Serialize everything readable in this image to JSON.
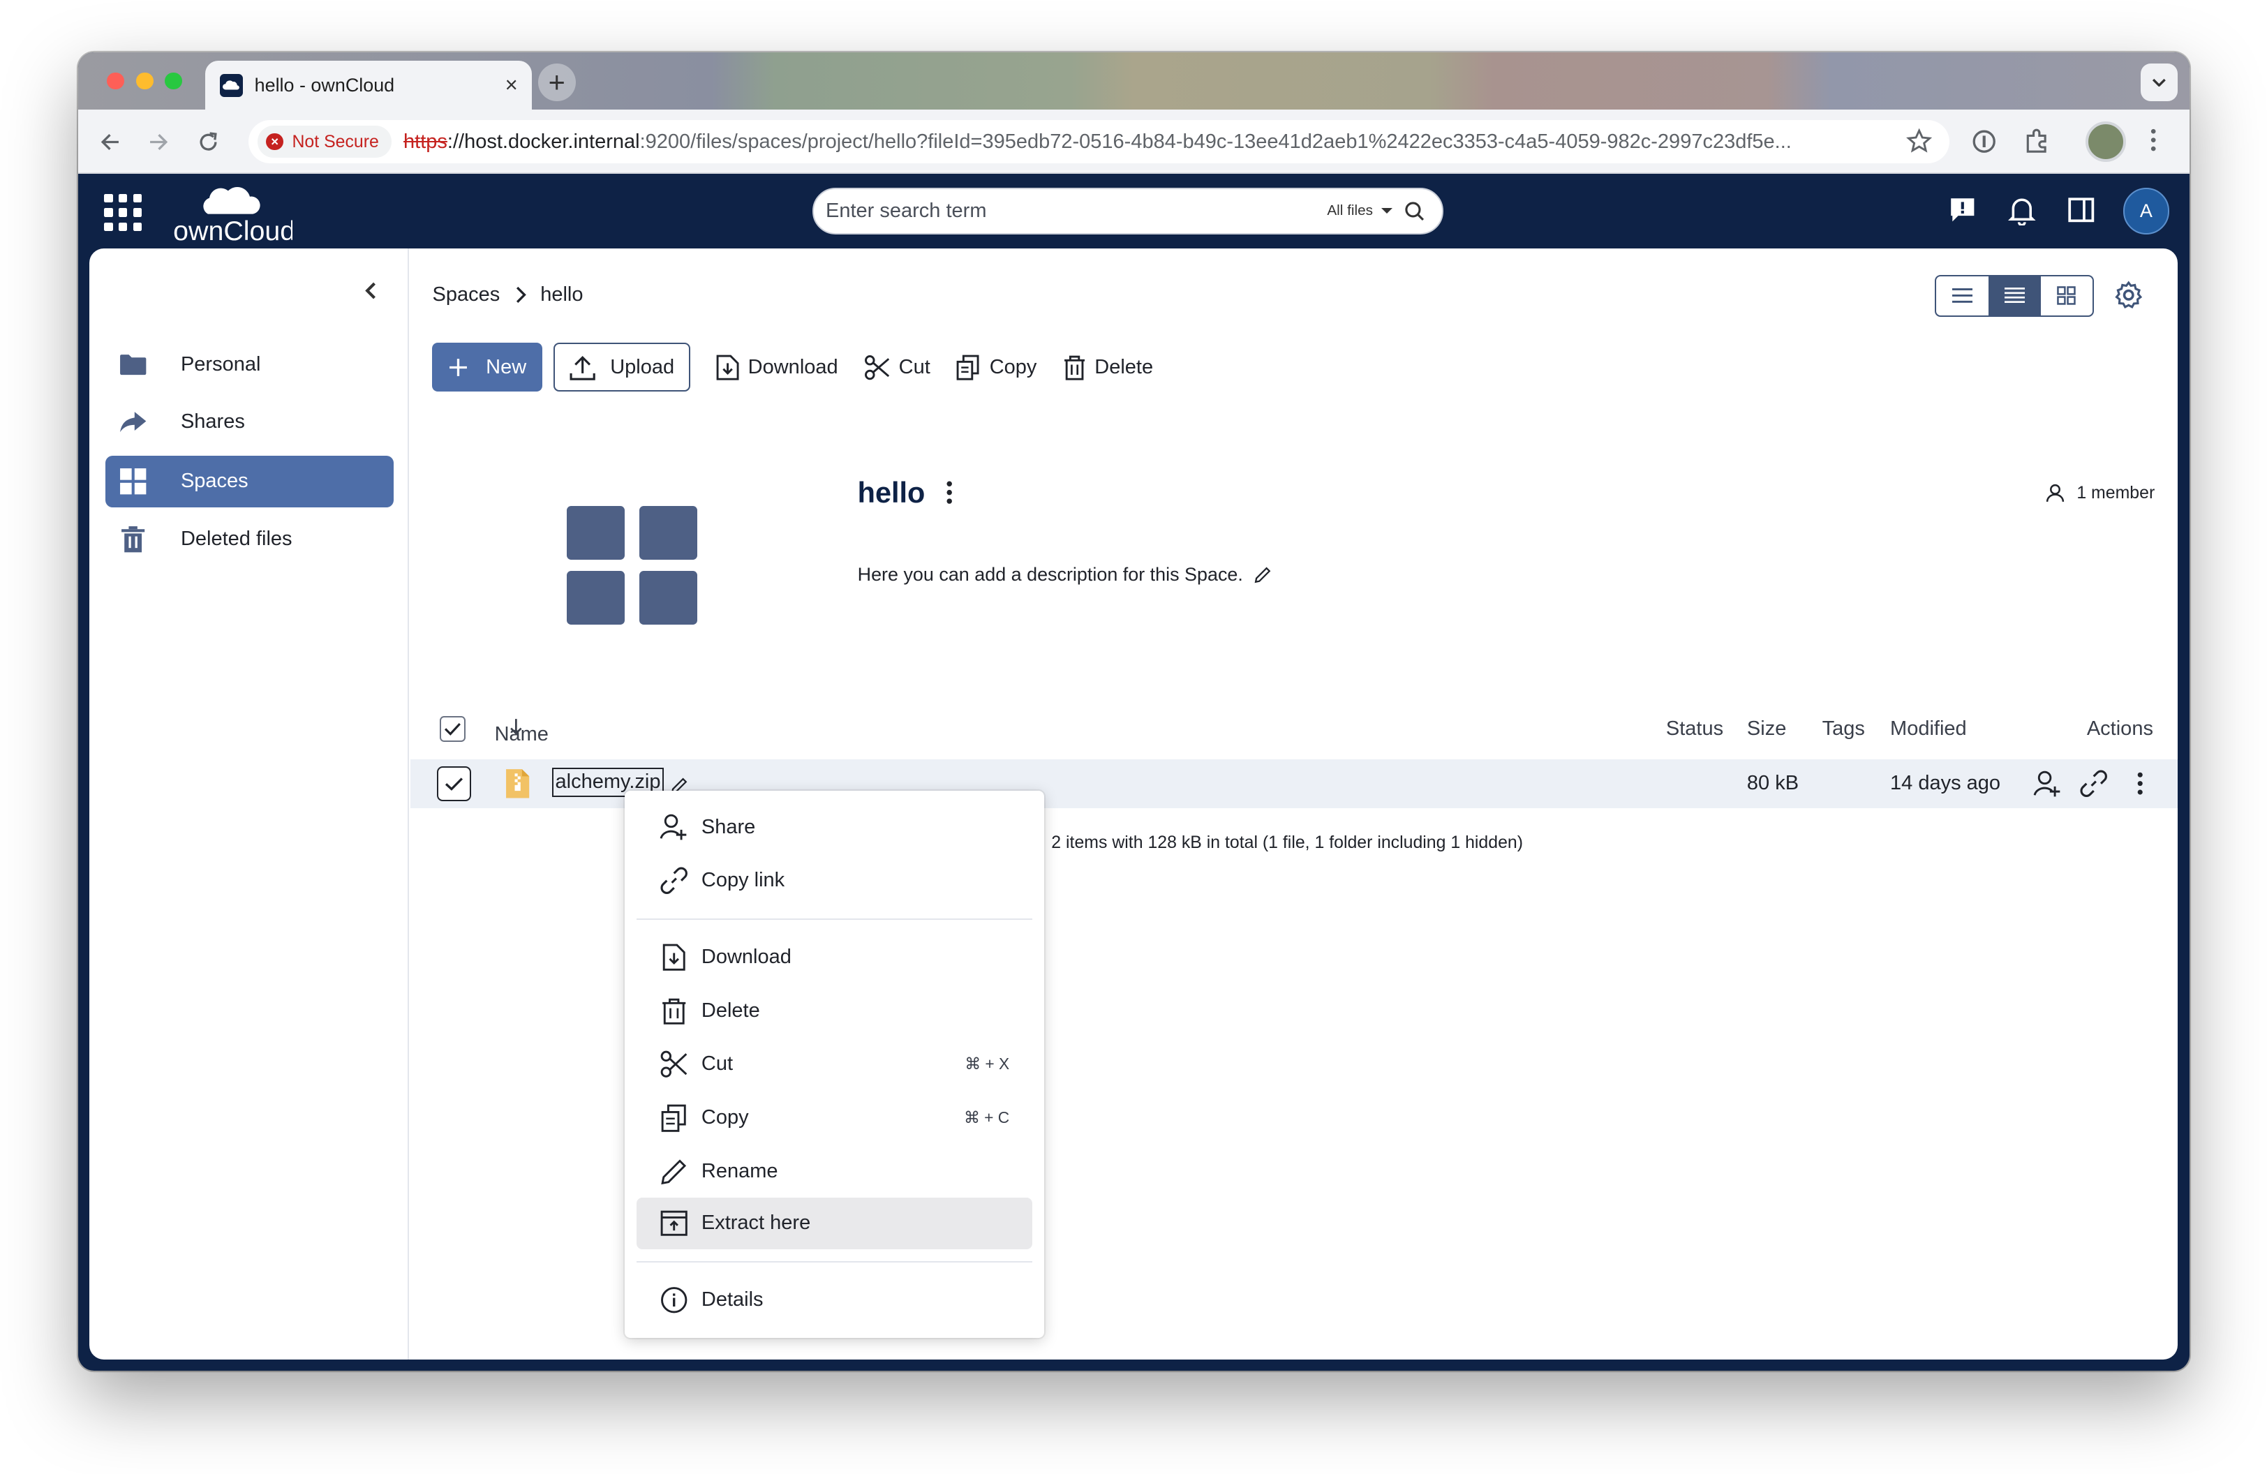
{
  "browser": {
    "tab_title": "hello - ownCloud",
    "new_tab": "+",
    "tab_close": "×",
    "security_label": "Not Secure",
    "url_scheme": "https",
    "url_host": "://host.docker.internal",
    "url_rest": ":9200/files/spaces/project/hello?fileId=395edb72-0516-4b84-b49c-13ee41d2aeb1%2422ec3353-c4a5-4059-982c-2997c23df5e..."
  },
  "header": {
    "search_placeholder": "Enter search term",
    "search_filter": "All files",
    "avatar_initial": "A"
  },
  "sidebar": {
    "items": [
      {
        "label": "Personal",
        "icon": "folder-icon"
      },
      {
        "label": "Shares",
        "icon": "share-arrow-icon"
      },
      {
        "label": "Spaces",
        "icon": "spaces-grid-icon",
        "active": true
      },
      {
        "label": "Deleted files",
        "icon": "trash-icon"
      }
    ]
  },
  "breadcrumb": [
    "Spaces",
    "hello"
  ],
  "toolbar": {
    "new_label": "New",
    "upload_label": "Upload",
    "download_label": "Download",
    "cut_label": "Cut",
    "copy_label": "Copy",
    "delete_label": "Delete"
  },
  "space": {
    "title": "hello",
    "members": "1 member",
    "description": "Here you can add a description for this Space."
  },
  "table": {
    "columns": {
      "name": "Name",
      "status": "Status",
      "size": "Size",
      "tags": "Tags",
      "modified": "Modified",
      "actions": "Actions"
    },
    "rows": [
      {
        "name": "alchemy.zip",
        "size": "80 kB",
        "modified": "14 days ago"
      }
    ],
    "summary": "2 items with 128 kB in total (1 file, 1 folder including 1 hidden)"
  },
  "context_menu": {
    "share": "Share",
    "copy_link": "Copy link",
    "download": "Download",
    "delete": "Delete",
    "cut": "Cut",
    "cut_shortcut": "⌘ + X",
    "copy": "Copy",
    "copy_shortcut": "⌘ + C",
    "rename": "Rename",
    "extract": "Extract here",
    "details": "Details"
  },
  "colors": {
    "app_navy": "#0e2246",
    "accent": "#4e6ea8",
    "row_selected": "#ecf0f6",
    "not_secure": "#c5221f",
    "zip_icon": "#f2c265"
  }
}
